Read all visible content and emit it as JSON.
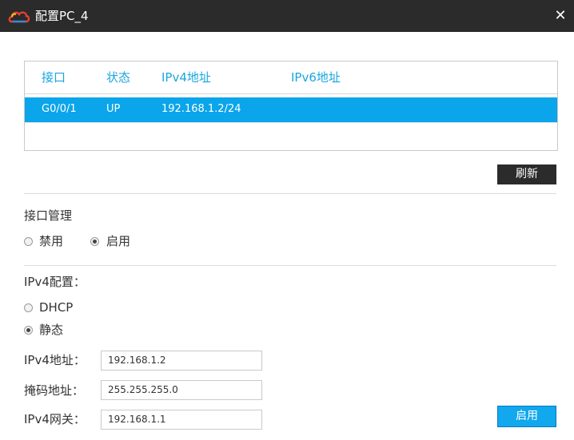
{
  "window": {
    "title": "配置PC_4",
    "close_symbol": "✕"
  },
  "interface_table": {
    "headers": [
      "接口",
      "状态",
      "IPv4地址",
      "IPv6地址"
    ],
    "rows": [
      {
        "interface": "G0/0/1",
        "status": "UP",
        "ipv4": "192.168.1.2/24",
        "ipv6": ""
      }
    ]
  },
  "refresh_button": "刷新",
  "interface_management": {
    "label": "接口管理",
    "options": [
      "禁用",
      "启用"
    ],
    "selected": "启用"
  },
  "ipv4_config": {
    "label": "IPv4配置：",
    "options": [
      "DHCP",
      "静态"
    ],
    "selected": "静态",
    "fields": {
      "address": {
        "label": "IPv4地址：",
        "value": "192.168.1.2"
      },
      "mask": {
        "label": "掩码地址：",
        "value": "255.255.255.0"
      },
      "gateway": {
        "label": "IPv4网关：",
        "value": "192.168.1.1"
      }
    }
  },
  "apply_button": "启用",
  "colors": {
    "accent": "#0aa5ea",
    "titlebar": "#2b2b2b",
    "header_text": "#1aa6e0"
  },
  "icons": {
    "logo": "cloud-logo-icon",
    "close": "close-icon"
  }
}
